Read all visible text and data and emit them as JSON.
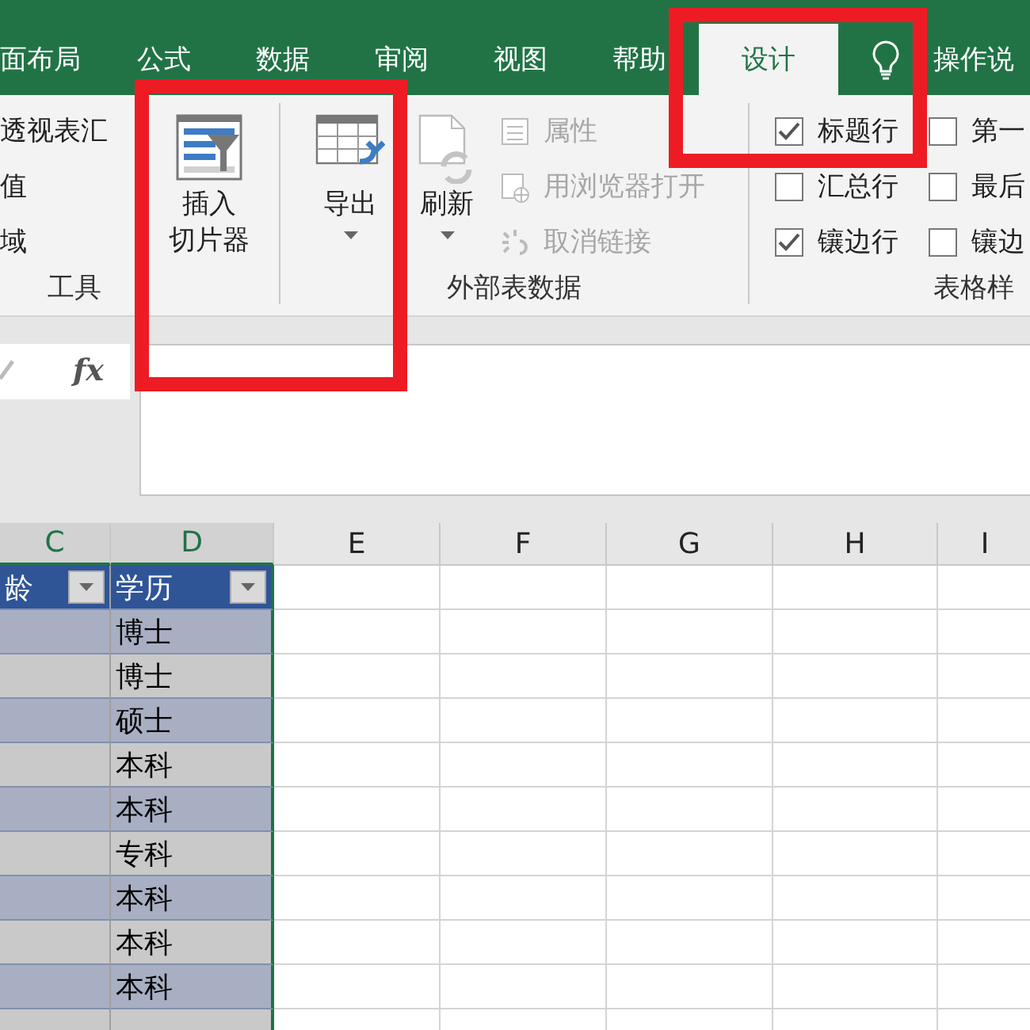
{
  "tabs": [
    {
      "label": "面布局",
      "selected": false
    },
    {
      "label": "公式",
      "selected": false
    },
    {
      "label": "数据",
      "selected": false
    },
    {
      "label": "审阅",
      "selected": false
    },
    {
      "label": "视图",
      "selected": false
    },
    {
      "label": "帮助",
      "selected": false
    },
    {
      "label": "设计",
      "selected": true
    }
  ],
  "tell_me": {
    "label": "操作说"
  },
  "ribbon": {
    "groups": [
      {
        "label": "工具",
        "commands": [
          {
            "label": "透视表汇"
          },
          {
            "label": "值"
          },
          {
            "label": "域"
          }
        ],
        "big_buttons": [
          {
            "label_lines": [
              "插入",
              "切片器"
            ],
            "dropdown": false
          }
        ]
      },
      {
        "label": "外部表数据",
        "big_buttons": [
          {
            "label_lines": [
              "导出"
            ],
            "dropdown": true
          },
          {
            "label_lines": [
              "刷新"
            ],
            "dropdown": true
          }
        ],
        "commands": [
          {
            "label": "属性",
            "disabled": true
          },
          {
            "label": "用浏览器打开",
            "disabled": true
          },
          {
            "label": "取消链接",
            "disabled": true
          }
        ]
      },
      {
        "label": "表格样",
        "options": [
          {
            "label": "标题行",
            "checked": true
          },
          {
            "label": "汇总行",
            "checked": false
          },
          {
            "label": "镶边行",
            "checked": true
          },
          {
            "label": "第一",
            "checked": false
          },
          {
            "label": "最后",
            "checked": false
          },
          {
            "label": "镶边",
            "checked": false
          }
        ]
      }
    ]
  },
  "formula_bar": {
    "function_label": "fx"
  },
  "sheet": {
    "columns": [
      {
        "label": "C",
        "selected": true
      },
      {
        "label": "D",
        "selected": true
      },
      {
        "label": "E",
        "selected": false
      },
      {
        "label": "F",
        "selected": false
      },
      {
        "label": "G",
        "selected": false
      },
      {
        "label": "H",
        "selected": false
      },
      {
        "label": "I",
        "selected": false
      }
    ],
    "table": {
      "headers": [
        "龄",
        "学历"
      ],
      "rows": [
        "博士",
        "博士",
        "硕士",
        "本科",
        "本科",
        "专科",
        "本科",
        "本科",
        "本科"
      ]
    }
  },
  "annotations": [
    {
      "kind": "highlight-box"
    },
    {
      "kind": "highlight-box"
    }
  ]
}
